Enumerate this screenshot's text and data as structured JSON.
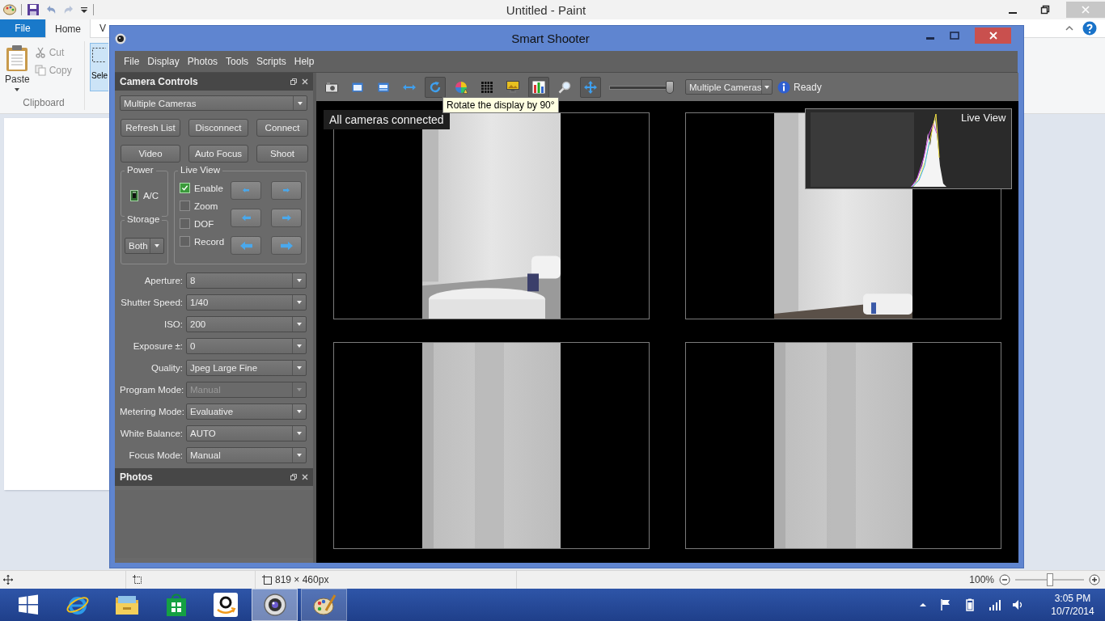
{
  "paint": {
    "title": "Untitled - Paint",
    "tabs": [
      {
        "label": "File",
        "kind": "file",
        "selected": false
      },
      {
        "label": "Home",
        "kind": "tab",
        "selected": true
      },
      {
        "label": "V",
        "kind": "tab",
        "selected": false
      }
    ],
    "clipboard": {
      "paste": "Paste",
      "cut": "Cut",
      "copy": "Copy",
      "group": "Clipboard"
    },
    "select": "Sele",
    "status_bar": {
      "image_size": "819 × 460px",
      "zoom": "100%",
      "zoom_slider": {
        "level": 0.5
      }
    }
  },
  "smart_shooter": {
    "title": "Smart Shooter",
    "menu": [
      "File",
      "Display",
      "Photos",
      "Tools",
      "Scripts",
      "Help"
    ],
    "camera_controls": {
      "title": "Camera Controls",
      "camera_select": "Multiple Cameras",
      "buttons": [
        "Refresh List",
        "Disconnect",
        "Connect",
        "Video",
        "Auto Focus",
        "Shoot"
      ],
      "power": {
        "title": "Power",
        "source": "A/C"
      },
      "storage": {
        "title": "Storage",
        "value": "Both"
      },
      "live_view": {
        "title": "Live View",
        "options": [
          {
            "label": "Enable",
            "checked": true
          },
          {
            "label": "Zoom",
            "checked": false
          },
          {
            "label": "DOF",
            "checked": false
          },
          {
            "label": "Record",
            "checked": false
          }
        ]
      },
      "settings": [
        {
          "label": "Aperture:",
          "value": "8",
          "disabled": false
        },
        {
          "label": "Shutter Speed:",
          "value": "1/40",
          "disabled": false
        },
        {
          "label": "ISO:",
          "value": "200",
          "disabled": false
        },
        {
          "label": "Exposure ±:",
          "value": "0",
          "disabled": false
        },
        {
          "label": "Quality:",
          "value": "Jpeg Large Fine",
          "disabled": false
        },
        {
          "label": "Program Mode:",
          "value": "Manual",
          "disabled": true
        },
        {
          "label": "Metering Mode:",
          "value": "Evaluative",
          "disabled": false
        },
        {
          "label": "White Balance:",
          "value": "AUTO",
          "disabled": false
        },
        {
          "label": "Focus Mode:",
          "value": "Manual",
          "disabled": false
        }
      ]
    },
    "photos": {
      "title": "Photos"
    },
    "toolbar": {
      "tools": [
        {
          "kind": "camera",
          "pressed": false
        },
        {
          "kind": "screen",
          "pressed": false
        },
        {
          "kind": "screen-small",
          "pressed": false
        },
        {
          "kind": "double-arrow",
          "pressed": false
        },
        {
          "kind": "rotate",
          "pressed": true
        },
        {
          "kind": "color-wheel",
          "pressed": false
        },
        {
          "kind": "grid",
          "pressed": false
        },
        {
          "kind": "monitor",
          "pressed": false
        },
        {
          "kind": "bar-chart",
          "pressed": true
        },
        {
          "kind": "search",
          "pressed": false
        },
        {
          "kind": "move",
          "pressed": true
        }
      ],
      "zoom_slider": {
        "level": 1
      },
      "camera_select": "Multiple Cameras",
      "status": "Ready"
    },
    "tooltip": "Rotate the display by 90°",
    "view": {
      "message": "All cameras connected",
      "live_view": {
        "title": "Live View"
      }
    }
  },
  "taskbar": {
    "apps": [
      {
        "kind": "ie",
        "running": false,
        "selected": false
      },
      {
        "kind": "explorer",
        "running": false,
        "selected": false
      },
      {
        "kind": "store",
        "running": false,
        "selected": false
      },
      {
        "kind": "amazon",
        "running": false,
        "selected": false
      },
      {
        "kind": "smart-shooter",
        "running": true,
        "selected": true
      },
      {
        "kind": "paint",
        "running": true,
        "selected": false
      }
    ],
    "time": "3:05 PM",
    "date": "10/7/2014"
  }
}
